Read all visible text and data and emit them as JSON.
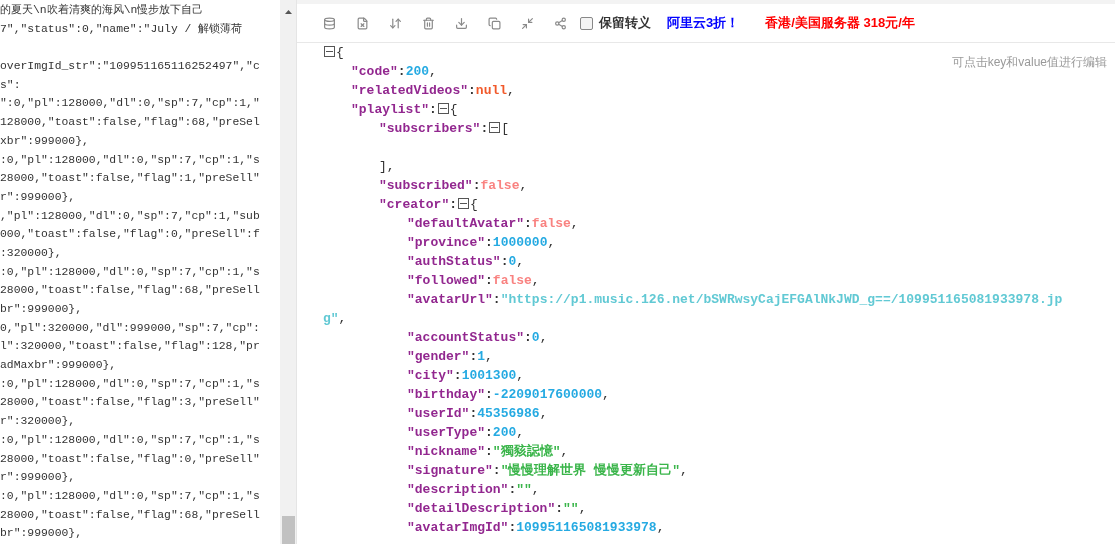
{
  "raw_text": {
    "lines": [
      {
        "kind": "text",
        "text": "的夏天\\n吹着清爽的海风\\n慢步放下自己"
      },
      {
        "kind": "text",
        "text": "7\",\"status\":0,\"name\":\"July / 解锁薄荷"
      },
      {
        "kind": "blank"
      },
      {
        "kind": "text",
        "text": "overImgId_str\":\"109951165116252497\",\"c"
      },
      {
        "kind": "text",
        "text": "s\":"
      },
      {
        "kind": "text",
        "text": "\":0,\"pl\":128000,\"dl\":0,\"sp\":7,\"cp\":1,\""
      },
      {
        "kind": "text",
        "text": "128000,\"toast\":false,\"flag\":68,\"preSel"
      },
      {
        "kind": "text",
        "text": "xbr\":999000},"
      },
      {
        "kind": "text",
        "text": ":0,\"pl\":128000,\"dl\":0,\"sp\":7,\"cp\":1,\"s"
      },
      {
        "kind": "text",
        "text": "28000,\"toast\":false,\"flag\":1,\"preSell\""
      },
      {
        "kind": "text",
        "text": "r\":999000},"
      },
      {
        "kind": "text",
        "text": ",\"pl\":128000,\"dl\":0,\"sp\":7,\"cp\":1,\"sub"
      },
      {
        "kind": "text",
        "text": "000,\"toast\":false,\"flag\":0,\"preSell\":f"
      },
      {
        "kind": "text",
        "text": ":320000},"
      },
      {
        "kind": "text",
        "text": ":0,\"pl\":128000,\"dl\":0,\"sp\":7,\"cp\":1,\"s"
      },
      {
        "kind": "text",
        "text": "28000,\"toast\":false,\"flag\":68,\"preSell"
      },
      {
        "kind": "text",
        "text": "br\":999000},"
      },
      {
        "kind": "text",
        "text": "0,\"pl\":320000,\"dl\":999000,\"sp\":7,\"cp\":"
      },
      {
        "kind": "text",
        "text": "l\":320000,\"toast\":false,\"flag\":128,\"pr"
      },
      {
        "kind": "text",
        "text": "adMaxbr\":999000},"
      },
      {
        "kind": "text",
        "text": ":0,\"pl\":128000,\"dl\":0,\"sp\":7,\"cp\":1,\"s"
      },
      {
        "kind": "text",
        "text": "28000,\"toast\":false,\"flag\":3,\"preSell\""
      },
      {
        "kind": "text",
        "text": "r\":320000},"
      },
      {
        "kind": "text",
        "text": ":0,\"pl\":128000,\"dl\":0,\"sp\":7,\"cp\":1,\"s"
      },
      {
        "kind": "text",
        "text": "28000,\"toast\":false,\"flag\":0,\"preSell\""
      },
      {
        "kind": "text",
        "text": "r\":999000},"
      },
      {
        "kind": "text",
        "text": ":0,\"pl\":128000,\"dl\":0,\"sp\":7,\"cp\":1,\"s"
      },
      {
        "kind": "text",
        "text": "28000,\"toast\":false,\"flag\":68,\"preSell"
      },
      {
        "kind": "text",
        "text": "br\":999000},"
      }
    ]
  },
  "toolbar": {
    "escape": {
      "label": "保留转义",
      "checked": false
    },
    "promos": [
      {
        "text": "阿里云3折！",
        "color": "#0000ff"
      },
      {
        "text": "香港/美国服务器 318元/年",
        "color": "#ff0000"
      }
    ]
  },
  "hint": "可点击key和value值进行编辑",
  "tree": {
    "kind": "object",
    "open": "{",
    "expanded": true,
    "children": [
      {
        "key": "\"code\"",
        "sep": ":",
        "kind": "number",
        "value": "200",
        "tail": ","
      },
      {
        "key": "\"relatedVideos\"",
        "sep": ":",
        "kind": "null",
        "value": "null",
        "tail": ","
      },
      {
        "key": "\"playlist\"",
        "sep": ":",
        "kind": "object",
        "open": "{",
        "expanded": true,
        "children": [
          {
            "key": "\"subscribers\"",
            "sep": ":",
            "kind": "array",
            "open": "[",
            "expanded": true,
            "close": "],"
          },
          {
            "key": "\"subscribed\"",
            "sep": ":",
            "kind": "boolean",
            "value": "false",
            "tail": ","
          },
          {
            "key": "\"creator\"",
            "sep": ":",
            "kind": "object",
            "open": "{",
            "expanded": true,
            "children": [
              {
                "key": "\"defaultAvatar\"",
                "sep": ":",
                "kind": "boolean",
                "value": "false",
                "tail": ","
              },
              {
                "key": "\"province\"",
                "sep": ":",
                "kind": "number",
                "value": "1000000",
                "tail": ","
              },
              {
                "key": "\"authStatus\"",
                "sep": ":",
                "kind": "number",
                "value": "0",
                "tail": ","
              },
              {
                "key": "\"followed\"",
                "sep": ":",
                "kind": "boolean",
                "value": "false",
                "tail": ","
              },
              {
                "key": "\"avatarUrl\"",
                "sep": ":",
                "kind": "url",
                "value": "\"https://p1.music.126.net/bSWRwsyCajEFGAlNkJWD_g==/109951165081933978.jpg\"",
                "tail": ","
              },
              {
                "key": "\"accountStatus\"",
                "sep": ":",
                "kind": "number",
                "value": "0",
                "tail": ","
              },
              {
                "key": "\"gender\"",
                "sep": ":",
                "kind": "number",
                "value": "1",
                "tail": ","
              },
              {
                "key": "\"city\"",
                "sep": ":",
                "kind": "number",
                "value": "1001300",
                "tail": ","
              },
              {
                "key": "\"birthday\"",
                "sep": ":",
                "kind": "number",
                "value": "-2209017600000",
                "tail": ","
              },
              {
                "key": "\"userId\"",
                "sep": ":",
                "kind": "number",
                "value": "45356986",
                "tail": ","
              },
              {
                "key": "\"userType\"",
                "sep": ":",
                "kind": "number",
                "value": "200",
                "tail": ","
              },
              {
                "key": "\"nickname\"",
                "sep": ":",
                "kind": "string",
                "value": "\"獨豥誋憶\"",
                "tail": ","
              },
              {
                "key": "\"signature\"",
                "sep": ":",
                "kind": "string",
                "value": "\"慢慢理解世界 慢慢更新自己\"",
                "tail": ","
              },
              {
                "key": "\"description\"",
                "sep": ":",
                "kind": "string",
                "value": "\"\"",
                "tail": ","
              },
              {
                "key": "\"detailDescription\"",
                "sep": ":",
                "kind": "string",
                "value": "\"\"",
                "tail": ","
              },
              {
                "key": "\"avatarImgId\"",
                "sep": ":",
                "kind": "number",
                "value": "109951165081933978",
                "tail": ","
              }
            ]
          }
        ]
      }
    ]
  }
}
